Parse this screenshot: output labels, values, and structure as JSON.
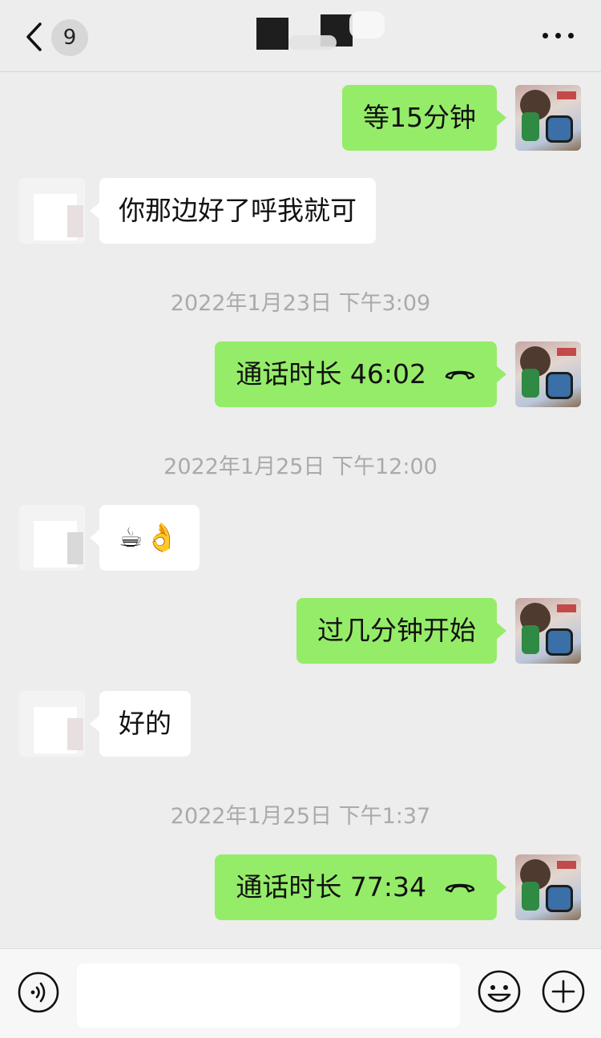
{
  "header": {
    "back_count": "9",
    "more_icon": "more-dots-icon"
  },
  "messages": [
    {
      "side": "right",
      "type": "text",
      "text": "等15分钟"
    },
    {
      "side": "left",
      "type": "text",
      "text": "你那边好了呼我就可"
    },
    {
      "type": "timestamp",
      "text": "2022年1月23日 下午3:09"
    },
    {
      "side": "right",
      "type": "call",
      "text": "通话时长 46:02",
      "icon": "phone-hangup-icon"
    },
    {
      "type": "timestamp",
      "text": "2022年1月25日 下午12:00"
    },
    {
      "side": "left",
      "type": "emoji",
      "text": "☕👌"
    },
    {
      "side": "right",
      "type": "text",
      "text": "过几分钟开始"
    },
    {
      "side": "left",
      "type": "text",
      "text": "好的"
    },
    {
      "type": "timestamp",
      "text": "2022年1月25日 下午1:37"
    },
    {
      "side": "right",
      "type": "call",
      "text": "通话时长 77:34",
      "icon": "phone-hangup-icon"
    }
  ],
  "input_bar": {
    "voice_icon": "voice-input-icon",
    "input_value": "",
    "emoji_icon": "emoji-icon",
    "plus_icon": "plus-icon"
  },
  "colors": {
    "background": "#ededed",
    "sent_bubble": "#95ec69",
    "received_bubble": "#ffffff",
    "timestamp_text": "#aaaaaa"
  }
}
